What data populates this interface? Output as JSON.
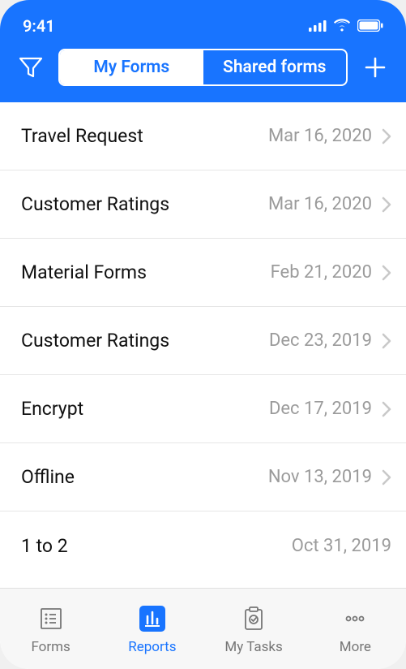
{
  "statusbar": {
    "time": "9:41"
  },
  "toolbar": {
    "tabs": {
      "myforms": "My Forms",
      "shared": "Shared forms"
    }
  },
  "list": {
    "items": [
      {
        "title": "Travel Request",
        "date": "Mar 16, 2020",
        "chevron": true
      },
      {
        "title": "Customer Ratings",
        "date": "Mar 16, 2020",
        "chevron": true
      },
      {
        "title": "Material Forms",
        "date": "Feb 21, 2020",
        "chevron": true
      },
      {
        "title": "Customer Ratings",
        "date": "Dec 23, 2019",
        "chevron": true
      },
      {
        "title": "Encrypt",
        "date": "Dec 17, 2019",
        "chevron": true
      },
      {
        "title": "Offline",
        "date": "Nov 13, 2019",
        "chevron": true
      },
      {
        "title": "1 to 2",
        "date": "Oct 31, 2019",
        "chevron": false
      }
    ]
  },
  "bottom": {
    "forms": "Forms",
    "reports": "Reports",
    "mytasks": "My Tasks",
    "more": "More"
  }
}
